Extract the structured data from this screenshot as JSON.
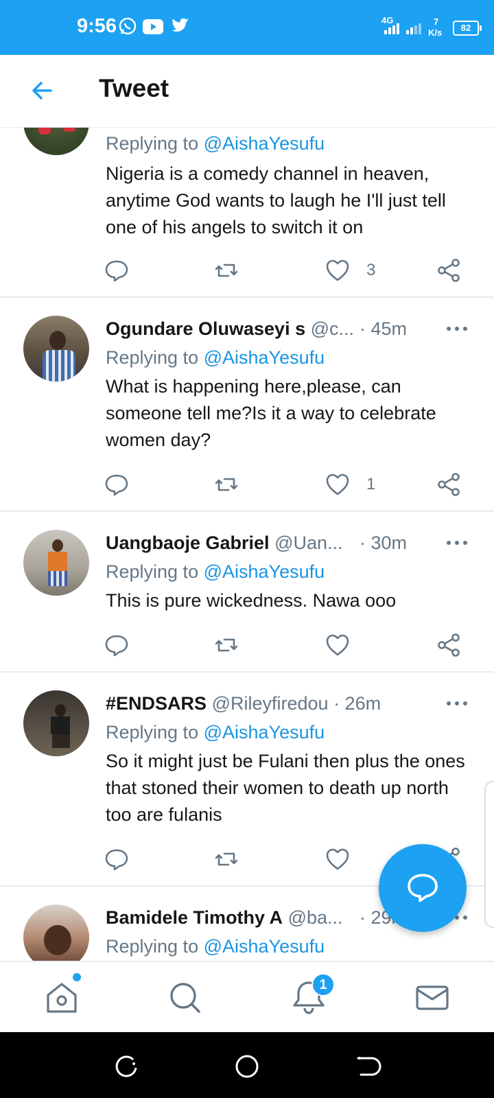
{
  "status_bar": {
    "time": "9:56",
    "network": "4G",
    "speed_value": "7",
    "speed_unit": "K/s",
    "battery": "82",
    "icons": [
      "whatsapp-icon",
      "youtube-icon",
      "twitter-icon",
      "signal-icon",
      "battery-icon"
    ]
  },
  "header": {
    "title": "Tweet",
    "back_icon": "arrow-left-icon"
  },
  "tweets": [
    {
      "name": "",
      "handle": "",
      "time": "",
      "replying_label": "Replying to ",
      "mention": "@AishaYesufu",
      "text": "Nigeria is a comedy channel in heaven, anytime God wants to laugh he I'll just tell one of his angels to switch it on",
      "likes": "3"
    },
    {
      "name": "Ogundare Oluwaseyi s",
      "handle": "@c...",
      "time": "· 45m",
      "replying_label": "Replying to ",
      "mention": "@AishaYesufu",
      "text": "What is happening here,please, can someone tell me?Is it a way to celebrate women day?",
      "likes": "1"
    },
    {
      "name": "Uangbaoje Gabriel",
      "handle": "@Uan...",
      "time": "· 30m",
      "replying_label": "Replying to ",
      "mention": "@AishaYesufu",
      "text": "This is pure wickedness. Nawa ooo",
      "likes": ""
    },
    {
      "name": "#ENDSARS",
      "handle": "@Rileyfiredou",
      "time": "· 26m",
      "replying_label": "Replying to ",
      "mention": "@AishaYesufu",
      "text": "So it might just be Fulani then plus the ones that stoned their women to death up north too are fulanis",
      "likes": ""
    },
    {
      "name": "Bamidele Timothy A",
      "handle": "@ba...",
      "time": "· 29m",
      "replying_label": "Replying to ",
      "mention": "@AishaYesufu",
      "text": "",
      "likes": ""
    }
  ],
  "bottom_nav": {
    "items": [
      "home-icon",
      "search-icon",
      "notifications-icon",
      "messages-icon"
    ],
    "notifications_badge": "1"
  },
  "colors": {
    "brand": "#1da1f2",
    "link": "#1b95e0",
    "muted": "#657786"
  }
}
